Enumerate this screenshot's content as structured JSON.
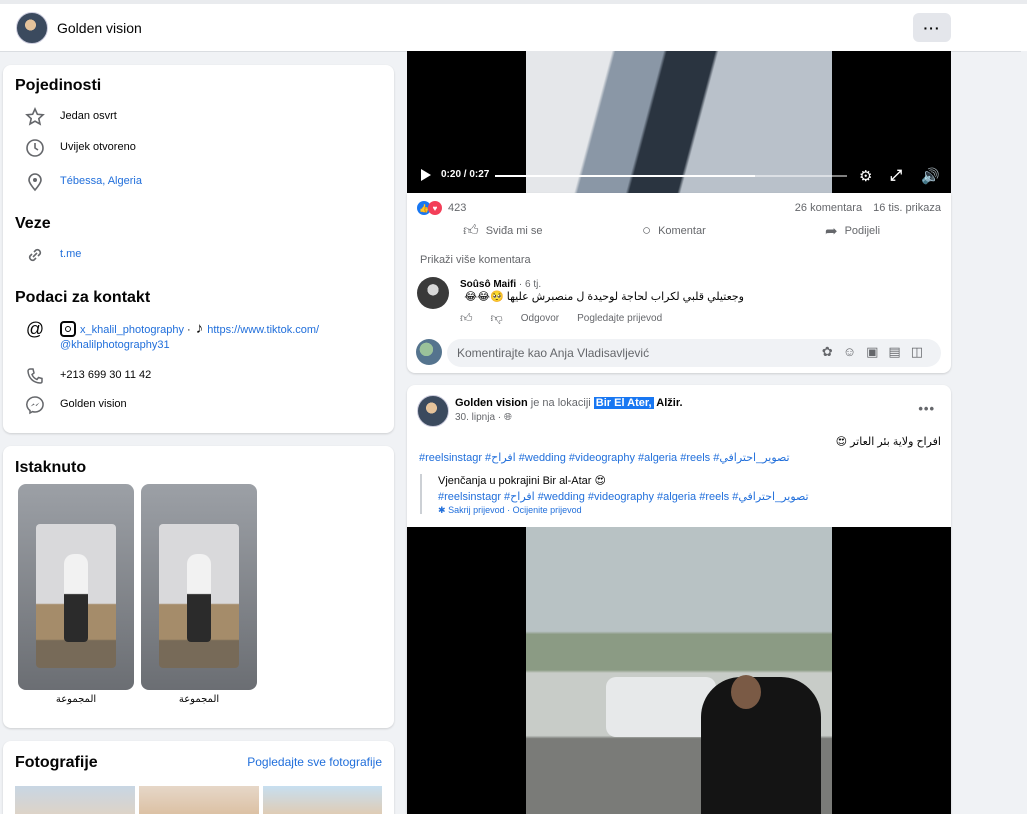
{
  "topbar": {
    "page_name": "Golden vision",
    "more_glyph": "···"
  },
  "details": {
    "title": "Pojedinosti",
    "rating": "Jedan osvrt",
    "hours": "Uvijek otvoreno",
    "location": "Tébessa, Algeria"
  },
  "links": {
    "title": "Veze",
    "link": "t.me"
  },
  "contact": {
    "title": "Podaci za kontakt",
    "instagram": "x_khalil_photography",
    "separator": " · ",
    "tiktok_url": "https://www.tiktok.com/",
    "tiktok_handle": "@khalilphotography31",
    "phone": "+213 699 30 11 42",
    "messenger": "Golden vision"
  },
  "featured": {
    "title": "Istaknuto",
    "items": [
      {
        "label": "المجموعة"
      },
      {
        "label": "المجموعة"
      }
    ]
  },
  "photos": {
    "title": "Fotografije",
    "see_all": "Pogledajte sve fotografije"
  },
  "video1": {
    "timecode": "0:20 / 0:27",
    "progress": 0.74
  },
  "post1": {
    "reaction_count": "423",
    "comments": "26 komentara",
    "views": "16 tis. prikaza",
    "like_label": "Sviđa mi se",
    "comment_label": "Komentar",
    "share_label": "Podijeli",
    "more_comments": "Prikaži više komentara",
    "comment": {
      "author": "Soûsô Maifi",
      "time": " · 6 tj.",
      "text": "وجعتيلي قلبي لكراب لحاجة لوحيدة ل منصبرش عليها 🥺😂😂",
      "reply": "Odgovor",
      "see_translation": "Pogledajte prijevod"
    },
    "composer_placeholder": "Komentirajte kao Anja Vladisavljević"
  },
  "post2": {
    "author": "Golden vision",
    "at_location": " je na lokaciji ",
    "location": "Bir El Ater,",
    "country": " Alžir.",
    "date": "30. lipnja · ",
    "arabic_text": "افراح ولاية بئر العاتر 😍",
    "hashtags": "#reelsinstagr #افراح #wedding #videography #algeria #reels #تصوير_احترافي",
    "translation": "Vjenčanja u pokrajini Bir al-Atar 😍",
    "translation_tags": "#reelsinstagr #افراح #wedding #videography #algeria #reels #تصوير_احترافي",
    "hide_translation": "Sakrij prijevod",
    "rate_translation": "Ocijenite prijevod",
    "link_sep": " · "
  }
}
